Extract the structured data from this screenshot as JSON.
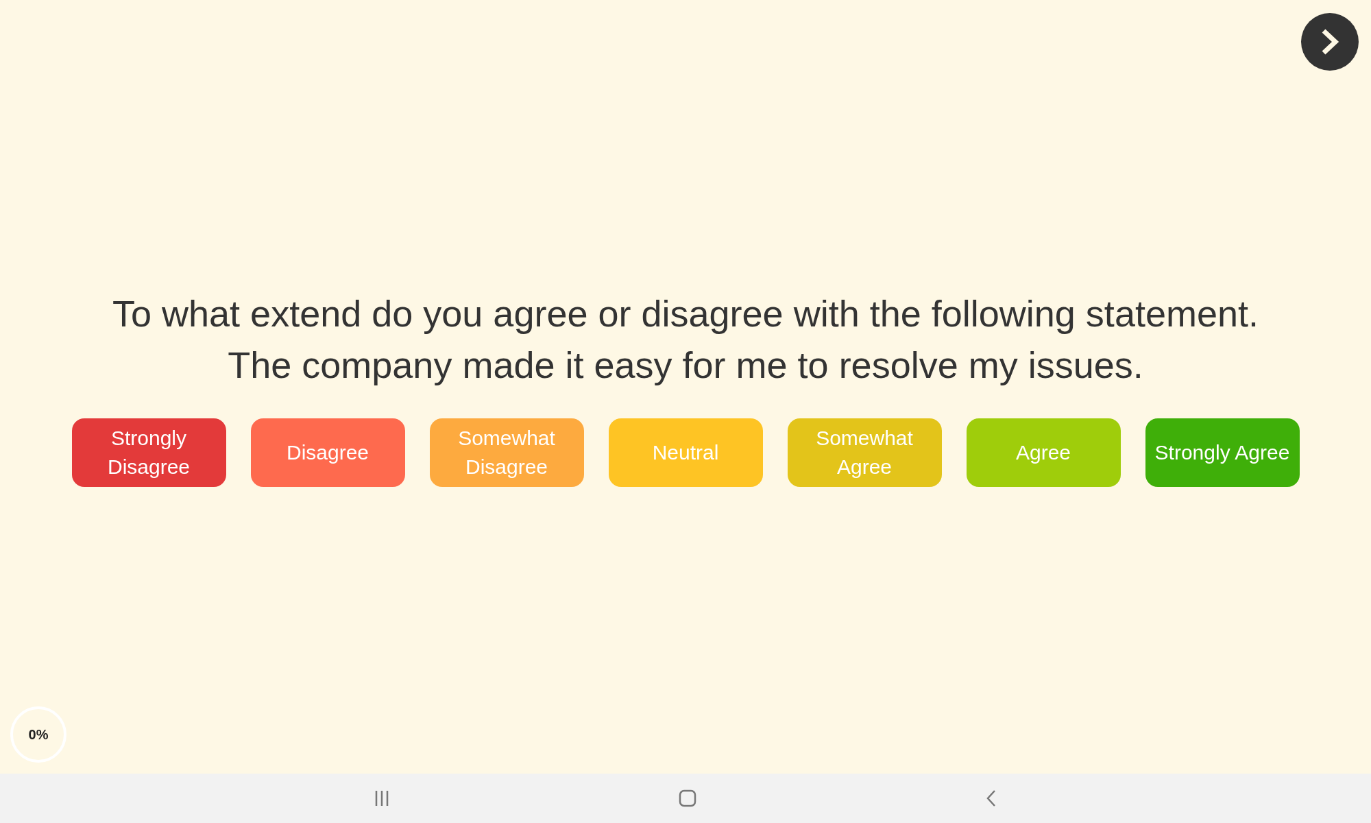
{
  "question": [
    "To what extend do you agree or disagree with the following statement.",
    "The company made it easy for me to resolve my issues."
  ],
  "answers": [
    {
      "label": "Strongly Disagree",
      "color": "#e33a3a"
    },
    {
      "label": "Disagree",
      "color": "#fe6a4e"
    },
    {
      "label": "Somewhat Disagree",
      "color": "#fdaa3f"
    },
    {
      "label": "Neutral",
      "color": "#fec424"
    },
    {
      "label": "Somewhat Agree",
      "color": "#e3c41a"
    },
    {
      "label": "Agree",
      "color": "#9fcd0b"
    },
    {
      "label": "Strongly Agree",
      "color": "#3faf09"
    }
  ],
  "progress": {
    "text": "0%"
  }
}
